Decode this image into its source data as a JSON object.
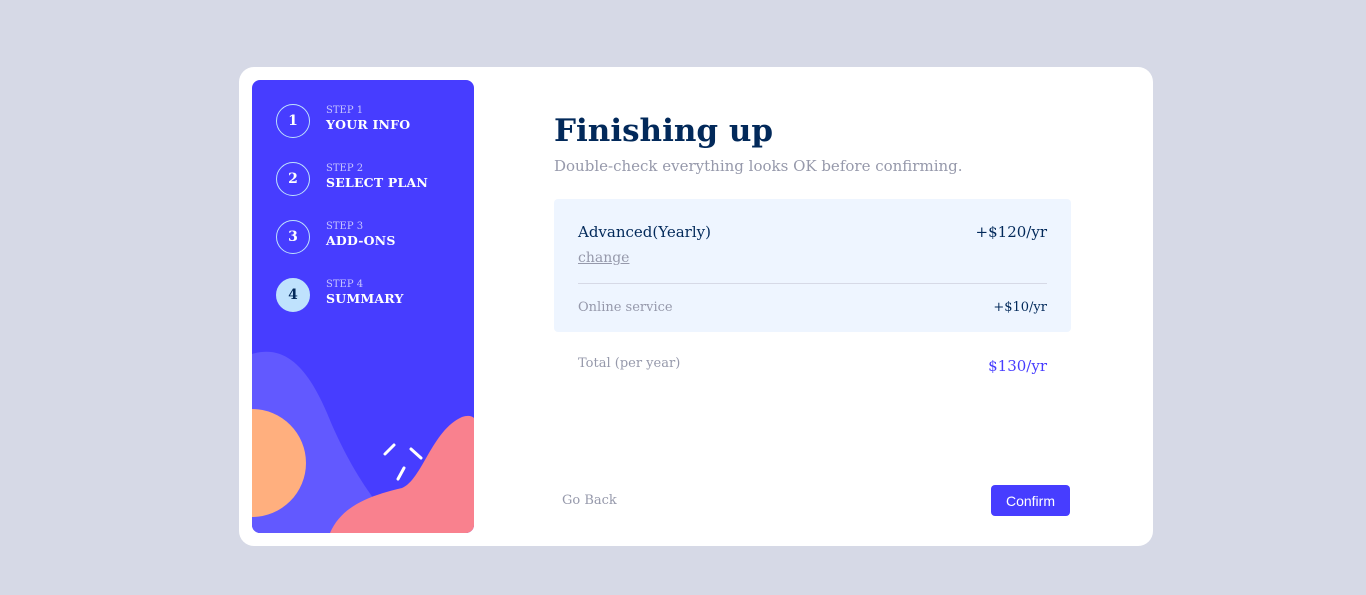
{
  "sidebar": {
    "steps": [
      {
        "number": "1",
        "label": "STEP 1",
        "title": "YOUR INFO",
        "active": false
      },
      {
        "number": "2",
        "label": "STEP 2",
        "title": "SELECT PLAN",
        "active": false
      },
      {
        "number": "3",
        "label": "STEP 3",
        "title": "ADD-ONS",
        "active": false
      },
      {
        "number": "4",
        "label": "STEP 4",
        "title": "SUMMARY",
        "active": true
      }
    ]
  },
  "main": {
    "title": "Finishing up",
    "description": "Double-check everything looks OK before confirming.",
    "summary": {
      "plan_name": "Advanced(Yearly)",
      "change_label": "change",
      "plan_price": "+$120/yr",
      "addons": [
        {
          "name": "Online service",
          "price": "+$10/yr"
        }
      ]
    },
    "total": {
      "label": "Total (per year)",
      "price": "$130/yr"
    },
    "actions": {
      "back_label": "Go Back",
      "confirm_label": "Confirm"
    }
  },
  "colors": {
    "page_background": "#d6d9e6",
    "sidebar": "#473dff",
    "accent": "#473dff",
    "active_step": "#bfe2fd",
    "heading": "#02295a",
    "muted": "#9699ab",
    "summary_background": "#eef5ff"
  }
}
